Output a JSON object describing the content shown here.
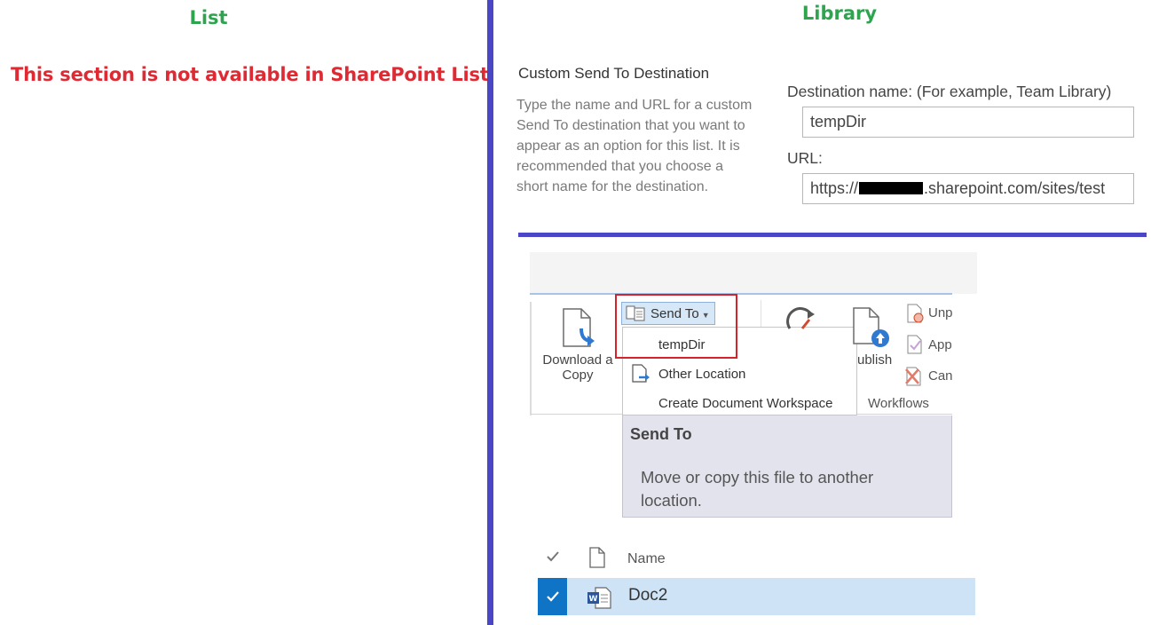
{
  "left_panel": {
    "title": "List",
    "message": "This section is not available in SharePoint List"
  },
  "right_panel": {
    "title": "Library",
    "section": {
      "title": "Custom Send To Destination",
      "description": "Type the name and URL for a custom Send To destination that you want to appear as an option for this list. It is recommended that you choose a short name for the destination.",
      "destination_label": "Destination name: (For example, Team Library)",
      "destination_value": "tempDir",
      "url_label": "URL:",
      "url_prefix": "https://",
      "url_suffix": ".sharepoint.com/sites/test"
    }
  },
  "ribbon": {
    "download_label_line1": "Download a",
    "download_label_line2": "Copy",
    "send_to_label": "Send To",
    "menu_items": [
      "tempDir",
      "Other Location",
      "Create Document Workspace"
    ],
    "publish_label": "ublish",
    "side_items": [
      "Unp",
      "App",
      "Can"
    ],
    "workflows_label": "Workflows"
  },
  "tooltip": {
    "title": "Send To",
    "body": "Move or copy this file to another location."
  },
  "list": {
    "name_header": "Name",
    "rows": [
      {
        "name": "Doc2"
      }
    ]
  },
  "colors": {
    "heading_green": "#2ea44f",
    "warning_red": "#e02a33",
    "divider_blue": "#4b46c6",
    "selection_blue": "#1074c6"
  }
}
